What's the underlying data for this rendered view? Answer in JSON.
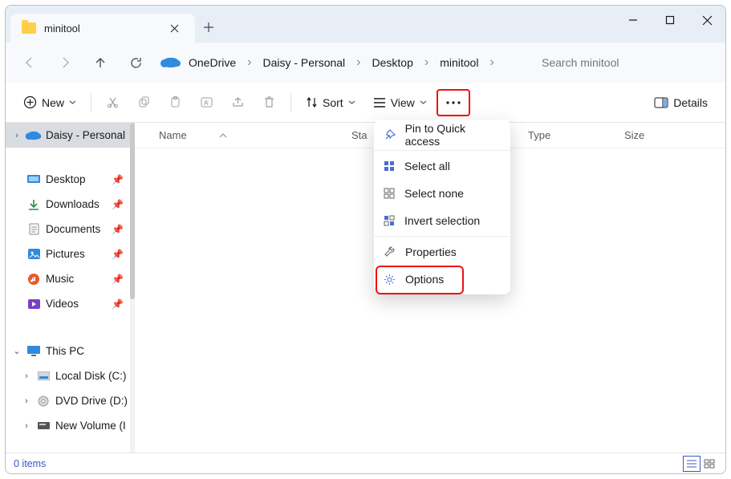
{
  "window": {
    "tab_title": "minitool",
    "controls": {
      "min": "minimize",
      "max": "maximize",
      "close": "close"
    }
  },
  "breadcrumb": {
    "root": "OneDrive",
    "items": [
      "Daisy - Personal",
      "Desktop",
      "minitool"
    ]
  },
  "search": {
    "placeholder": "Search minitool"
  },
  "toolbar": {
    "new_label": "New",
    "sort_label": "Sort",
    "view_label": "View",
    "details_label": "Details"
  },
  "columns": {
    "name": "Name",
    "status_abbrev": "Sta",
    "date": "",
    "type": "Type",
    "size": "Size"
  },
  "sidebar": {
    "quick_root": "Daisy - Personal",
    "pinned": [
      "Desktop",
      "Downloads",
      "Documents",
      "Pictures",
      "Music",
      "Videos"
    ],
    "this_pc": "This PC",
    "drives": [
      "Local Disk (C:)",
      "DVD Drive (D:)",
      "New Volume (I"
    ]
  },
  "menu": {
    "pin": "Pin to Quick access",
    "select_all": "Select all",
    "select_none": "Select none",
    "invert": "Invert selection",
    "properties": "Properties",
    "options": "Options"
  },
  "status": {
    "count": "0 items"
  }
}
